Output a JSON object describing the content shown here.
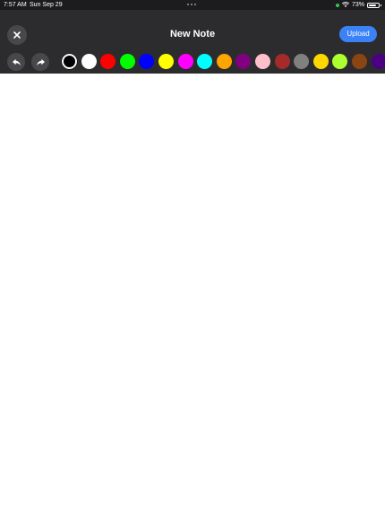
{
  "status_bar": {
    "time": "7:57 AM",
    "date": "Sun Sep 29",
    "battery": "73%"
  },
  "header": {
    "title": "New Note",
    "upload_label": "Upload",
    "close_icon": "close-icon",
    "undo_icon": "undo-icon",
    "redo_icon": "redo-icon"
  },
  "palette": {
    "selected": "#000000",
    "colors": [
      "#000000",
      "#ffffff",
      "#ff0000",
      "#00ff00",
      "#0000ff",
      "#ffff00",
      "#ff00ff",
      "#00ffff",
      "#ffa500",
      "#800080",
      "#ffc0cb",
      "#a52a2a",
      "#808080",
      "#ffd700",
      "#adff2f",
      "#8b4513",
      "#4b0082"
    ]
  }
}
